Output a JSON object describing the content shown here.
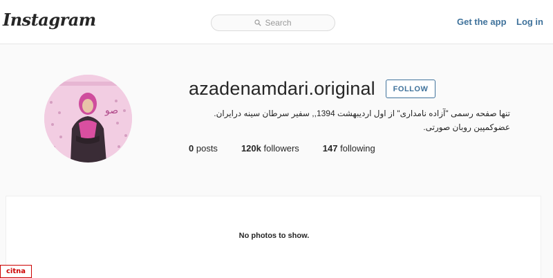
{
  "header": {
    "logo_text": "Instagram",
    "search_placeholder": "Search",
    "get_app_label": "Get the app",
    "login_label": "Log in"
  },
  "profile": {
    "username": "azadenamdari.original",
    "follow_label": "FOLLOW",
    "bio": "تنها صفحه رسمی \"آزاده نامداری\" از اول اردیبهشت 1394,, سفیر سرطان سینه درایران. عضوکمپین روبان صورتی.",
    "stats": {
      "posts_count": "0",
      "posts_label": "posts",
      "followers_count": "120k",
      "followers_label": "followers",
      "following_count": "147",
      "following_label": "following"
    }
  },
  "main": {
    "empty_message": "No photos to show."
  },
  "watermark": {
    "text": "citna"
  },
  "colors": {
    "link_blue": "#3f729b",
    "page_bg": "#fafafa",
    "avatar_bg_pink": "#f3c9e1"
  }
}
